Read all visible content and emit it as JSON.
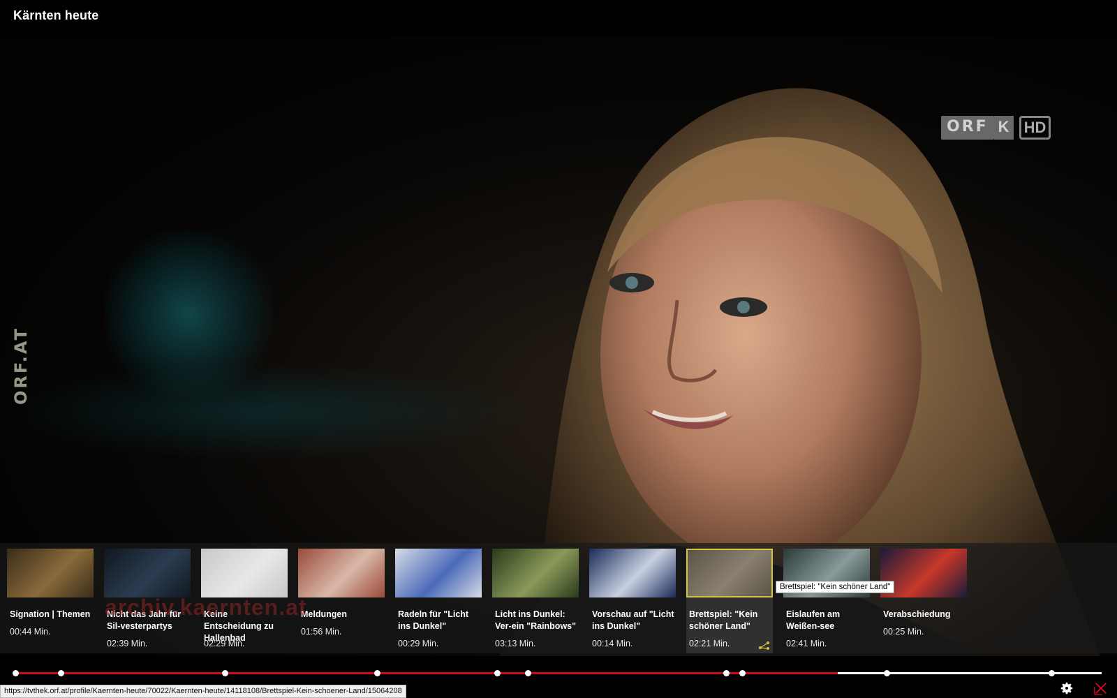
{
  "header": {
    "title": "Kärnten heute"
  },
  "video": {
    "watermark": "ORF.AT",
    "logo": {
      "orf": "ORF",
      "k": "K",
      "hd": "HD"
    },
    "background_text": "archiv.kaernten.at"
  },
  "chapters": [
    {
      "title": "Signation | Themen",
      "duration": "00:44 Min."
    },
    {
      "title": "Nicht das Jahr für Sil-vesterpartys",
      "duration": "02:39 Min."
    },
    {
      "title": "Keine Entscheidung zu Hallenbad",
      "duration": "02:29 Min."
    },
    {
      "title": "Meldungen",
      "duration": "01:56 Min."
    },
    {
      "title": "Radeln für \"Licht ins Dunkel\"",
      "duration": "00:29 Min."
    },
    {
      "title": "Licht ins Dunkel: Ver-ein \"Rainbows\"",
      "duration": "03:13 Min."
    },
    {
      "title": "Vorschau auf \"Licht ins Dunkel\"",
      "duration": "00:14 Min."
    },
    {
      "title": "Brettspiel: \"Kein schöner Land\"",
      "duration": "02:21 Min."
    },
    {
      "title": "Eislaufen am Weißen-see",
      "duration": "02:41 Min."
    },
    {
      "title": "Verabschiedung",
      "duration": "00:25 Min."
    }
  ],
  "active_chapter_index": 7,
  "tooltip": "Brettspiel: \"Kein schöner Land\"",
  "progress": {
    "played_fraction": 0.757
  },
  "status_url": "https://tvthek.orf.at/profile/Kaernten-heute/70022/Kaernten-heute/14118108/Brettspiel-Kein-schoener-Land/15064208",
  "colors": {
    "accent_red": "#d0091b",
    "active_border": "#d4c63a"
  }
}
